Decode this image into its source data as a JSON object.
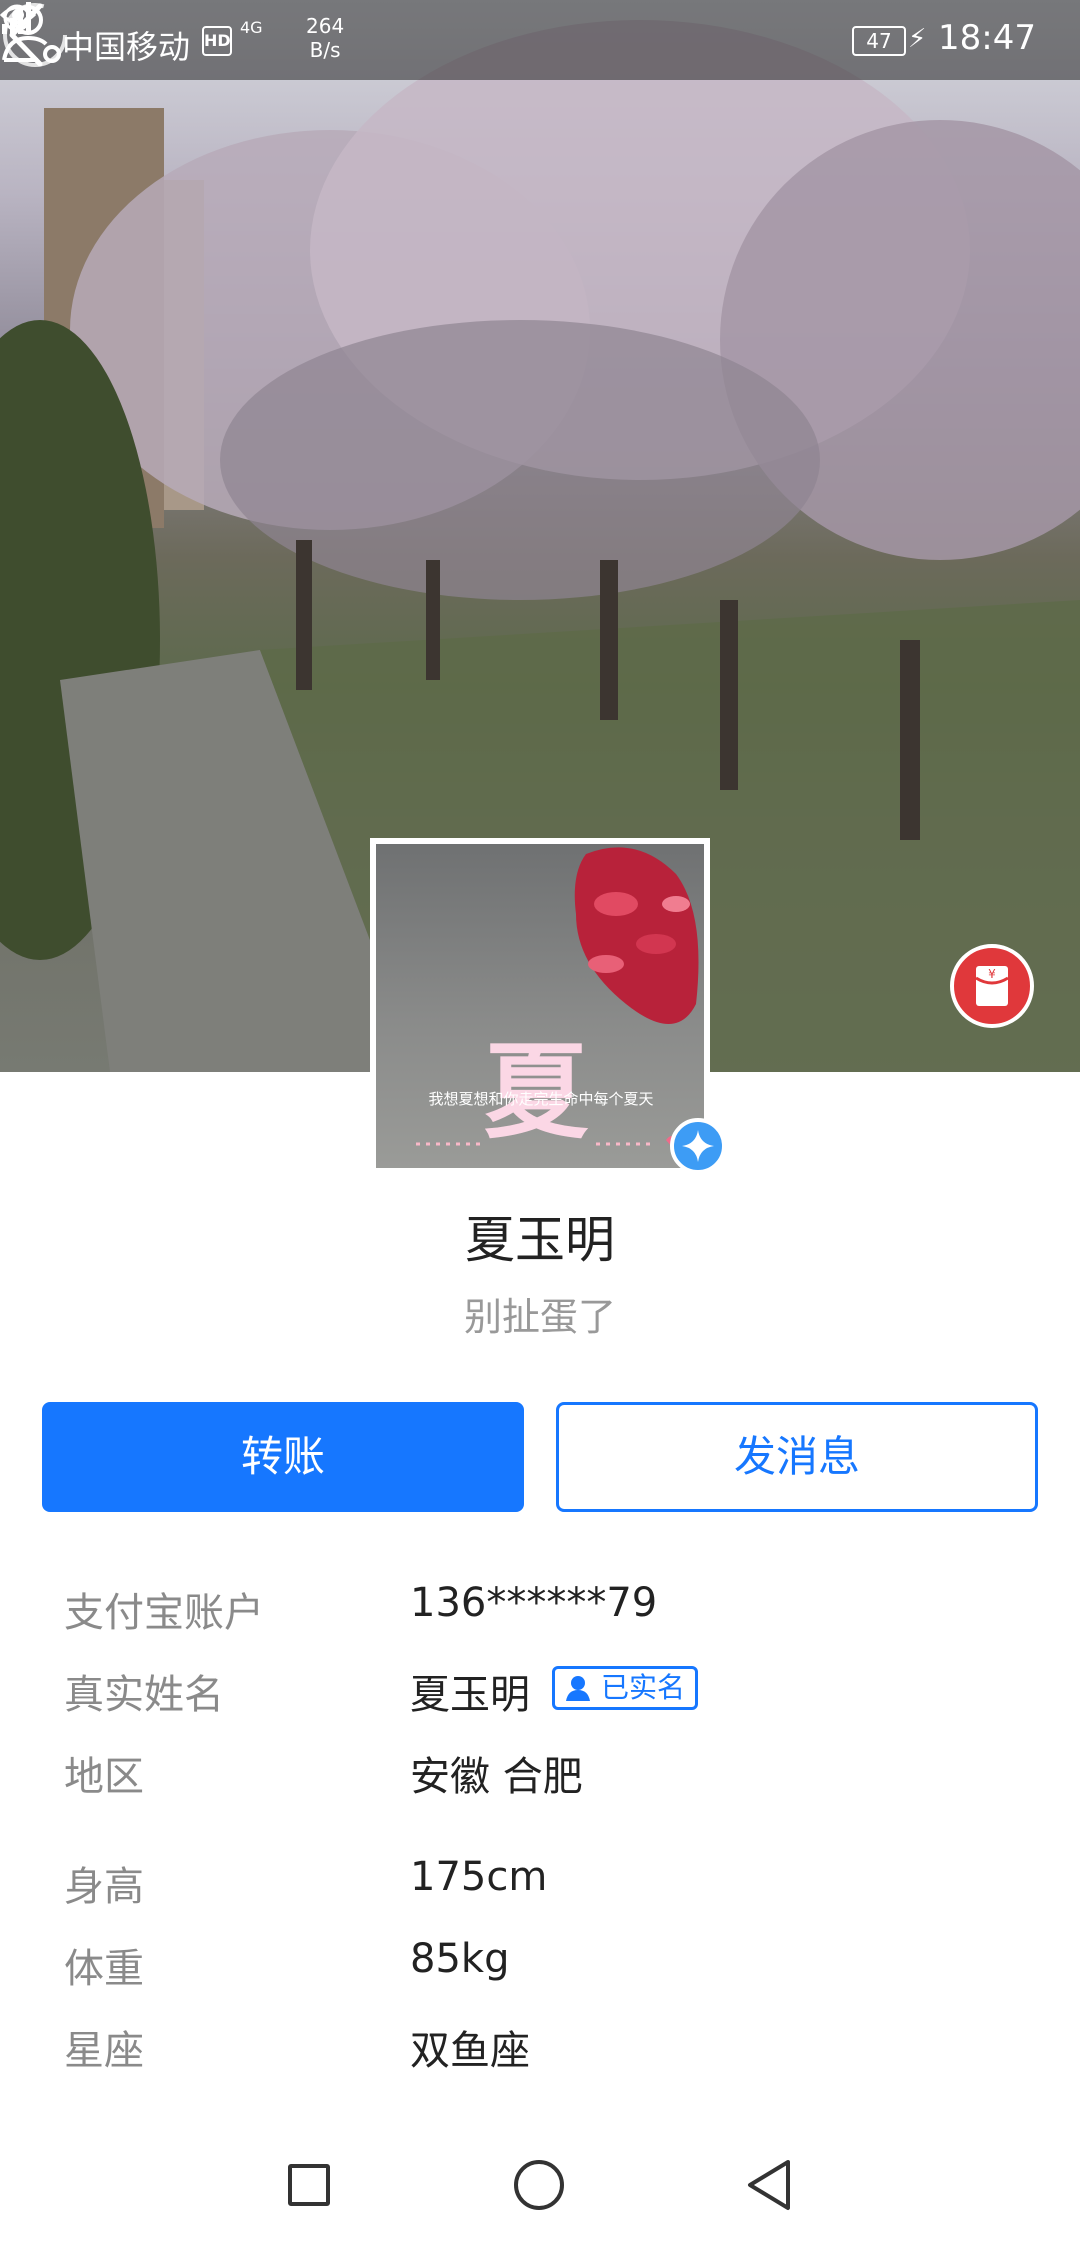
{
  "status_bar": {
    "carrier": "中国移动",
    "hd_badge": "HD",
    "network": "4G",
    "speed_value": "264",
    "speed_unit": "B/s",
    "battery": "47",
    "time": "18:47"
  },
  "header": {
    "back_icon": "chevron-left-icon",
    "profile_settings_icon": "person-settings-icon"
  },
  "avatar": {
    "character": "夏",
    "caption": "我想夏想和你走完生命中每个夏天",
    "verified_icon": "star-badge-icon"
  },
  "profile": {
    "name": "夏玉明",
    "signature": "别扯蛋了"
  },
  "actions": {
    "transfer_label": "转账",
    "message_label": "发消息"
  },
  "info": [
    {
      "label": "支付宝账户",
      "value": "136******79"
    },
    {
      "label": "真实姓名",
      "value": "夏玉明",
      "tag": "已实名"
    },
    {
      "label": "地区",
      "value": "安徽 合肥"
    },
    {
      "label": "身高",
      "value": "175cm"
    },
    {
      "label": "体重",
      "value": "85kg"
    },
    {
      "label": "星座",
      "value": "双鱼座"
    }
  ],
  "colors": {
    "primary": "#1677ff",
    "redpacket": "#e0383b",
    "label_gray": "#8a8a8a"
  },
  "navbar": {
    "recent_icon": "square-icon",
    "home_icon": "circle-icon",
    "back_icon": "triangle-back-icon"
  }
}
